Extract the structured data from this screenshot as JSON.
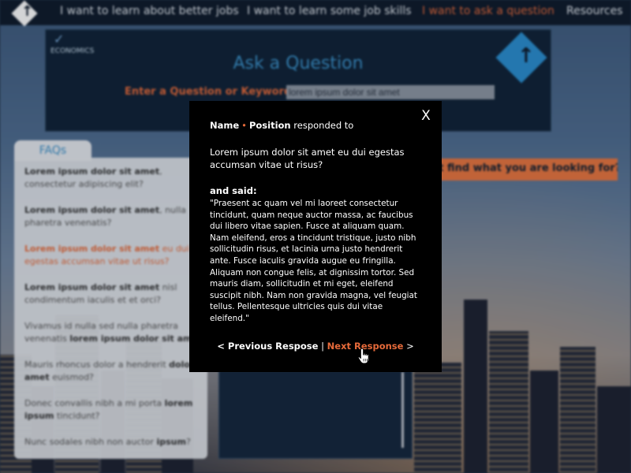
{
  "nav": {
    "items": [
      {
        "label": "I want to learn about better jobs",
        "active": false
      },
      {
        "label": "I want to learn some job skills",
        "active": false
      },
      {
        "label": "I want to ask a question",
        "active": true
      },
      {
        "label": "Resources",
        "active": false
      }
    ]
  },
  "header": {
    "logo_text": "ECONOMICS",
    "title": "Ask a Question",
    "keyword_label": "Enter a Question or Keyword:",
    "keyword_value": "lorem ipsum dolor sit amet"
  },
  "faqs": {
    "tab_label": "FAQs",
    "items": [
      {
        "bold": "Lorem ipsum dolor sit amet",
        "rest": ", consectetur adipiscing elit?",
        "highlighted": false
      },
      {
        "bold": "Lorem ipsum dolor sit amet",
        "rest": ", nulla pharetra venenatis?",
        "highlighted": false
      },
      {
        "bold": "Lorem ipsum dolor sit amet",
        "rest": " eu dui egestas accumsan vitae ut risus?",
        "highlighted": true
      },
      {
        "bold": "Lorem ipsum dolor sit amet",
        "rest": " nisl condimentum iaculis et et orci?",
        "highlighted": false
      },
      {
        "pre": "Vivamus id nulla sed nulla pharetra venenatis ",
        "bold": "lorem ipsum dolor sit amet",
        "highlighted": false
      },
      {
        "pre": "Mauris rhoncus dolor a hendrerit ",
        "bold": "dolor sit amet",
        "rest": " euismod?",
        "highlighted": false
      },
      {
        "pre": "Donec convallis nibh a mi porta ",
        "bold": "lorem ipsum",
        "rest": " tincidunt?",
        "highlighted": false
      },
      {
        "pre": "Nunc sodales nibh non auctor ",
        "bold": "ipsum",
        "rest": "?",
        "highlighted": false
      }
    ]
  },
  "cant_find_label": "n't find what you are looking for?",
  "modal": {
    "close_label": "X",
    "responder_name": "Name",
    "responder_sep": "•",
    "responder_position": "Position",
    "responded_to": "responded to",
    "question": "Lorem ipsum dolor sit amet eu dui egestas accumsan vitae ut risus?",
    "said_label": "and said:",
    "quote": "\"Praesent ac quam vel mi laoreet consectetur tincidunt, quam neque auctor massa, ac faucibus dui libero vitae sapien. Fusce at aliquam quam. Nam eleifend, eros a tincidunt tristique, justo nibh sollicitudin risus, et lacinia urna justo hendrerit ante. Fusce iaculis gravida augue eu fringilla. Aliquam non congue felis, at dignissim tortor. Sed mauris diam, sollicitudin et mi eget, eleifend suscipit nibh. Nam non gravida magna, vel feugiat tellus. Pellentesque ultricies quis dui vitae eleifend.\"",
    "prev_arrow": "<",
    "prev_label": "Previous Respose",
    "divider": "|",
    "next_label": "Next Response",
    "next_arrow": ">"
  },
  "colors": {
    "accent": "#e66a3a",
    "brand_blue": "#3a90c8",
    "modal_bg": "#000000"
  },
  "icons": {
    "nav_logo": "up-arrow-diamond-icon",
    "econ_logo": "checkmark-icon",
    "header_badge": "up-arrow-diamond-icon",
    "close": "close-icon",
    "cursor": "hand-pointer-icon"
  }
}
